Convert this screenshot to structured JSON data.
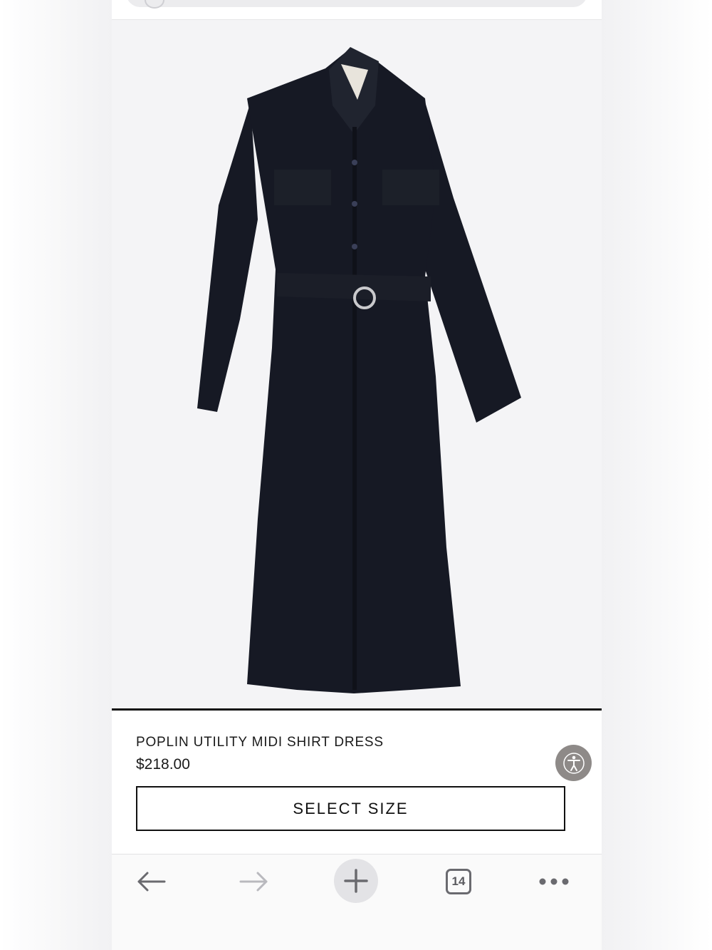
{
  "product": {
    "name": "POPLIN UTILITY MIDI SHIRT DRESS",
    "price": "$218.00",
    "select_size_label": "SELECT SIZE",
    "image_color": "#161924"
  },
  "toolbar": {
    "back_icon": "arrow-left-icon",
    "forward_icon": "arrow-right-icon",
    "new_tab_icon": "plus-icon",
    "tab_count": "14",
    "more_icon": "more-dots-icon"
  },
  "accessibility": {
    "icon": "accessibility-icon"
  },
  "colors": {
    "text": "#1a1a1a",
    "border": "#111111",
    "a11y_button": "#8e8a88"
  }
}
